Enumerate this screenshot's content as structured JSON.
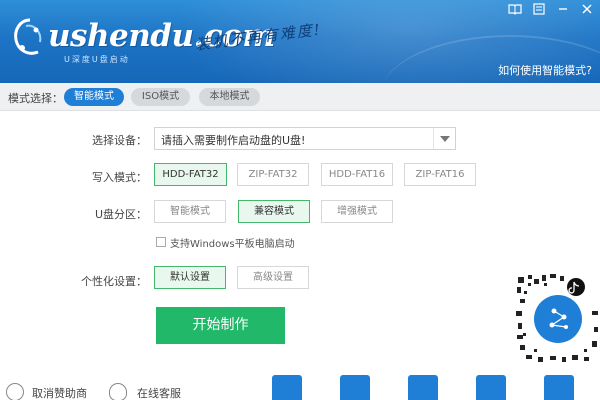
{
  "header": {
    "logo_text": "ushendu",
    "logo_suffix": ".com",
    "logo_subtitle": "U深度U盘启动",
    "slogan": "装机不再有难度!",
    "help_link": "如何使用智能模式?",
    "controls": [
      "book-icon",
      "menu-icon",
      "minimize-icon",
      "close-icon"
    ]
  },
  "modebar": {
    "label": "模式选择：",
    "tabs": [
      {
        "label": "智能模式",
        "active": true
      },
      {
        "label": "ISO模式",
        "active": false
      },
      {
        "label": "本地模式",
        "active": false
      }
    ]
  },
  "form": {
    "device_label": "选择设备：",
    "device_value": "请插入需要制作启动盘的U盘!",
    "write_label": "写入模式：",
    "write_options": [
      "HDD-FAT32",
      "ZIP-FAT32",
      "HDD-FAT16",
      "ZIP-FAT16"
    ],
    "write_selected": "HDD-FAT32",
    "partition_label": "U盘分区：",
    "partition_options": [
      "智能模式",
      "兼容模式",
      "增强模式"
    ],
    "partition_selected": "兼容模式",
    "checkbox_label": "支持Windows平板电脑启动",
    "checkbox_checked": false,
    "personal_label": "个性化设置：",
    "personal_options": [
      "默认设置",
      "高级设置"
    ],
    "personal_selected": "默认设置",
    "start_label": "开始制作"
  },
  "footer": {
    "items": [
      "取消赞助商",
      "在线客服"
    ],
    "tools": [
      "upload-icon",
      "drive-icon",
      "convert-icon",
      "monitor-icon",
      "search-icon"
    ]
  },
  "colors": {
    "brand_blue": "#1f7ed6",
    "accent_green": "#21b869",
    "selected_green_bg": "#e9f8ee"
  }
}
